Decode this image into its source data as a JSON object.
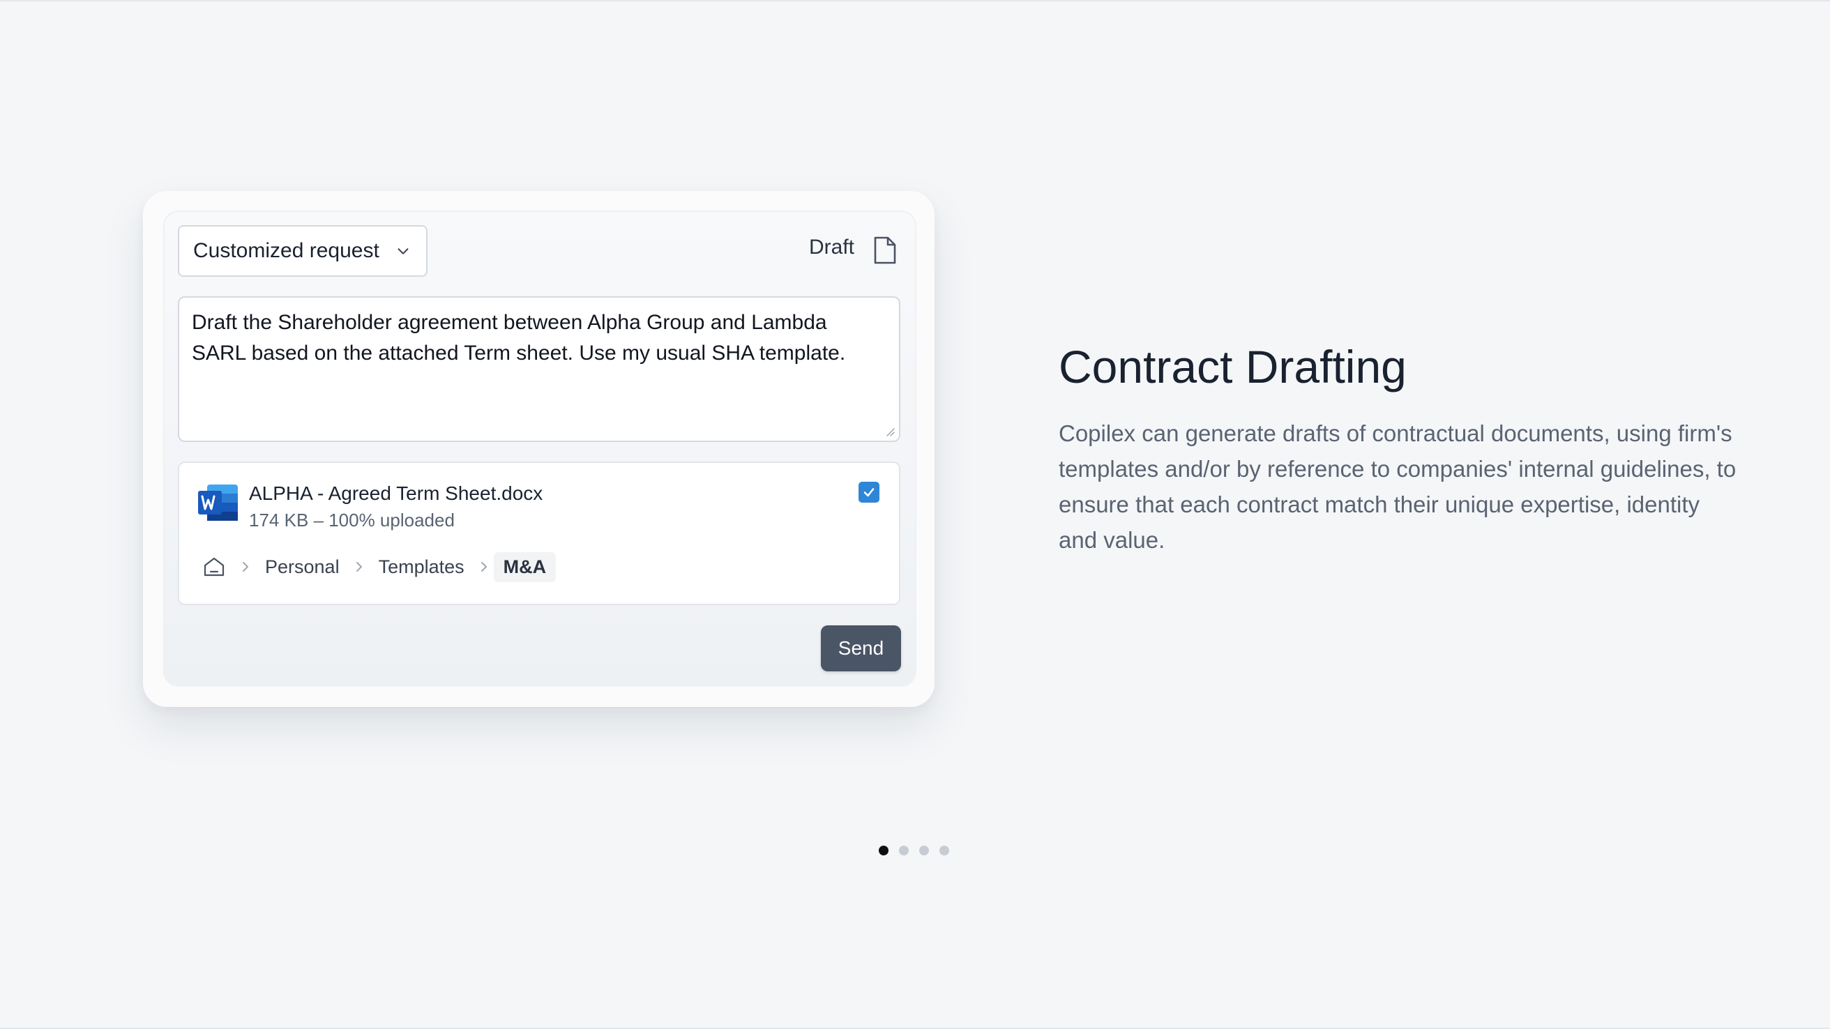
{
  "request_select": {
    "label": "Customized request"
  },
  "draft": {
    "label": "Draft"
  },
  "prompt": {
    "line1": "Draft the Shareholder agreement between Alpha Group and Lambda",
    "line2": "SARL based on the attached Term sheet. Use my usual SHA template."
  },
  "attachment": {
    "file_name": "ALPHA - Agreed Term Sheet.docx",
    "status": "174 KB – 100% uploaded",
    "checked": true
  },
  "breadcrumb": {
    "items": [
      "Personal",
      "Templates",
      "M&A"
    ]
  },
  "send": {
    "label": "Send"
  },
  "feature": {
    "title": "Contract Drafting",
    "description": "Copilex can generate drafts of contractual documents, using firm's templates and/or by reference to companies' internal guidelines, to ensure that each contract match their unique expertise, identity and value."
  },
  "pagination": {
    "total": 4,
    "active": 1
  },
  "colors": {
    "accent": "#2f86d6",
    "send_button": "#4a5566",
    "background": "#f4f6f8",
    "word_blue": "#185abd"
  }
}
